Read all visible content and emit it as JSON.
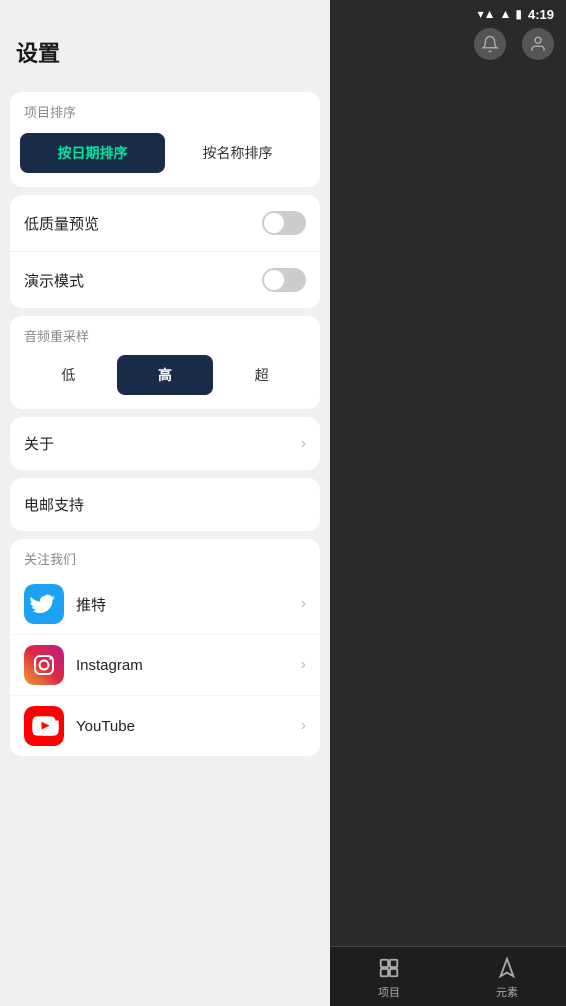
{
  "statusBar": {
    "time": "4:19",
    "wifiIcon": "▼",
    "signalIcon": "▲",
    "batteryIcon": "🔋"
  },
  "page": {
    "title": "设置"
  },
  "sortSection": {
    "label": "项目排序",
    "btn1": "按日期排序",
    "btn2": "按名称排序",
    "activeIndex": 0
  },
  "toggleSection": {
    "items": [
      {
        "label": "低质量预览",
        "on": false
      },
      {
        "label": "演示模式",
        "on": false
      }
    ]
  },
  "audioSection": {
    "label": "音频重采样",
    "options": [
      "低",
      "高",
      "超"
    ],
    "activeIndex": 1
  },
  "menuItems": [
    {
      "label": "关于",
      "hasChevron": true
    },
    {
      "label": "电邮支持",
      "hasChevron": false
    }
  ],
  "followSection": {
    "label": "关注我们",
    "items": [
      {
        "name": "推特",
        "platform": "twitter"
      },
      {
        "name": "Instagram",
        "platform": "instagram"
      },
      {
        "name": "YouTube",
        "platform": "youtube"
      }
    ]
  },
  "bottomNav": {
    "items": [
      {
        "label": "项目",
        "icon": "⊡"
      },
      {
        "label": "元素",
        "icon": "◈"
      }
    ]
  }
}
